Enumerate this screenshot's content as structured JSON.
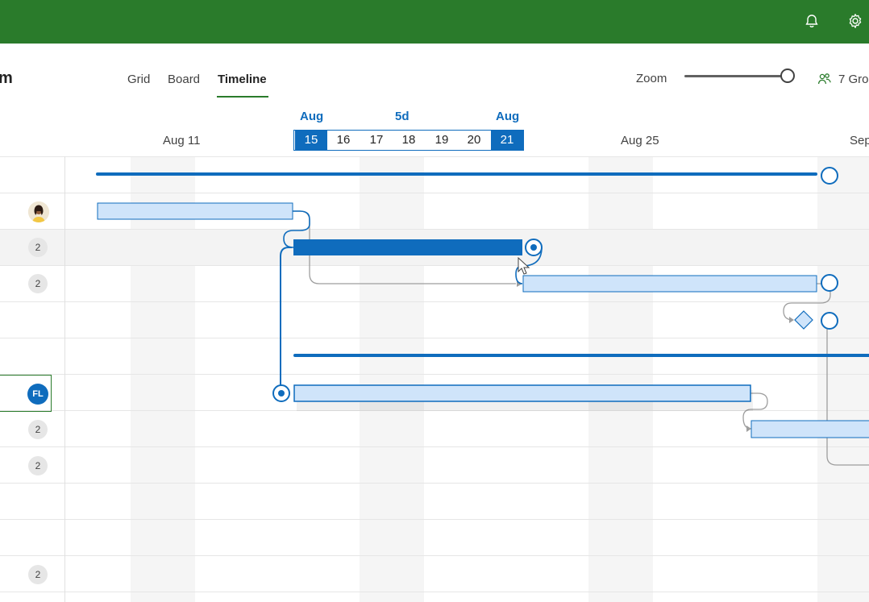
{
  "topbar": {
    "color": "#2a7b2b",
    "icons": [
      "bell-icon",
      "gear-icon"
    ]
  },
  "plan": {
    "title": "m"
  },
  "tabs": [
    {
      "label": "Grid",
      "active": false
    },
    {
      "label": "Board",
      "active": false
    },
    {
      "label": "Timeline",
      "active": true
    }
  ],
  "zoom": {
    "label": "Zoom",
    "level": 1.0
  },
  "groups": {
    "label": "7 Gro",
    "icon": "people-icon"
  },
  "timeline": {
    "dates": [
      "Aug 11",
      "Aug 25",
      "Sep"
    ],
    "selection": {
      "start_month": "Aug",
      "end_month": "Aug",
      "duration": "5d",
      "days": [
        "15",
        "16",
        "17",
        "18",
        "19",
        "20",
        "21"
      ]
    }
  },
  "rows": [
    {
      "assignee": ""
    },
    {
      "assignee": "avatar"
    },
    {
      "assignee": "2"
    },
    {
      "assignee": "2"
    },
    {
      "assignee": ""
    },
    {
      "assignee": ""
    },
    {
      "assignee": "FL"
    },
    {
      "assignee": "2"
    },
    {
      "assignee": "2"
    },
    {
      "assignee": ""
    },
    {
      "assignee": ""
    },
    {
      "assignee": "2"
    }
  ],
  "colors": {
    "accent": "#0f6cbd",
    "bar_fill": "#cfe4fa",
    "selected_bar": "#0f6cbd",
    "brand": "#2a7b2b"
  }
}
